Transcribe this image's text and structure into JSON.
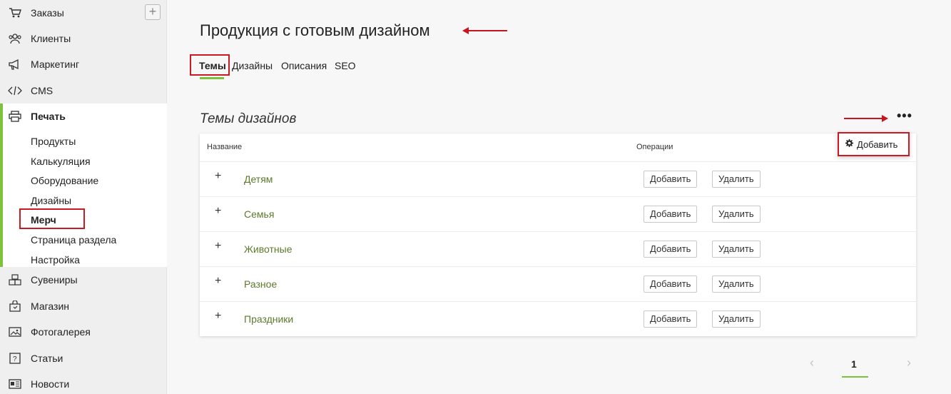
{
  "sidebar": {
    "add_label": "+",
    "items": [
      {
        "label": "Заказы",
        "icon": "cart-icon"
      },
      {
        "label": "Клиенты",
        "icon": "users-icon"
      },
      {
        "label": "Маркетинг",
        "icon": "megaphone-icon"
      },
      {
        "label": "CMS",
        "icon": "code-icon"
      },
      {
        "label": "Печать",
        "icon": "printer-icon"
      },
      {
        "label": "Сувениры",
        "icon": "boxes-icon"
      },
      {
        "label": "Магазин",
        "icon": "shop-icon"
      },
      {
        "label": "Фотогалерея",
        "icon": "gallery-icon"
      },
      {
        "label": "Статьи",
        "icon": "article-icon"
      },
      {
        "label": "Новости",
        "icon": "news-icon"
      }
    ],
    "print_subitems": [
      "Продукты",
      "Калькуляция",
      "Оборудование",
      "Дизайны",
      "Мерч",
      "Страница раздела",
      "Настройка"
    ]
  },
  "main": {
    "title": "Продукция с готовым дизайном",
    "tabs": [
      "Темы",
      "Дизайны",
      "Описания",
      "SEO"
    ],
    "section_title": "Темы дизайнов",
    "more_label": "•••",
    "dropdown_label": "Добавить",
    "table": {
      "headers": [
        "Название",
        "Операции"
      ],
      "rows": [
        {
          "name": "Детям"
        },
        {
          "name": "Семья"
        },
        {
          "name": "Животные"
        },
        {
          "name": "Разное"
        },
        {
          "name": "Праздники"
        }
      ],
      "add_label": "Добавить",
      "delete_label": "Удалить",
      "expand_label": "+"
    },
    "pagination": {
      "prev": "‹",
      "page": "1",
      "next": "›"
    }
  },
  "colors": {
    "accent": "#7cc23a",
    "highlight": "#cc1a22",
    "link": "#5d7a2c"
  }
}
